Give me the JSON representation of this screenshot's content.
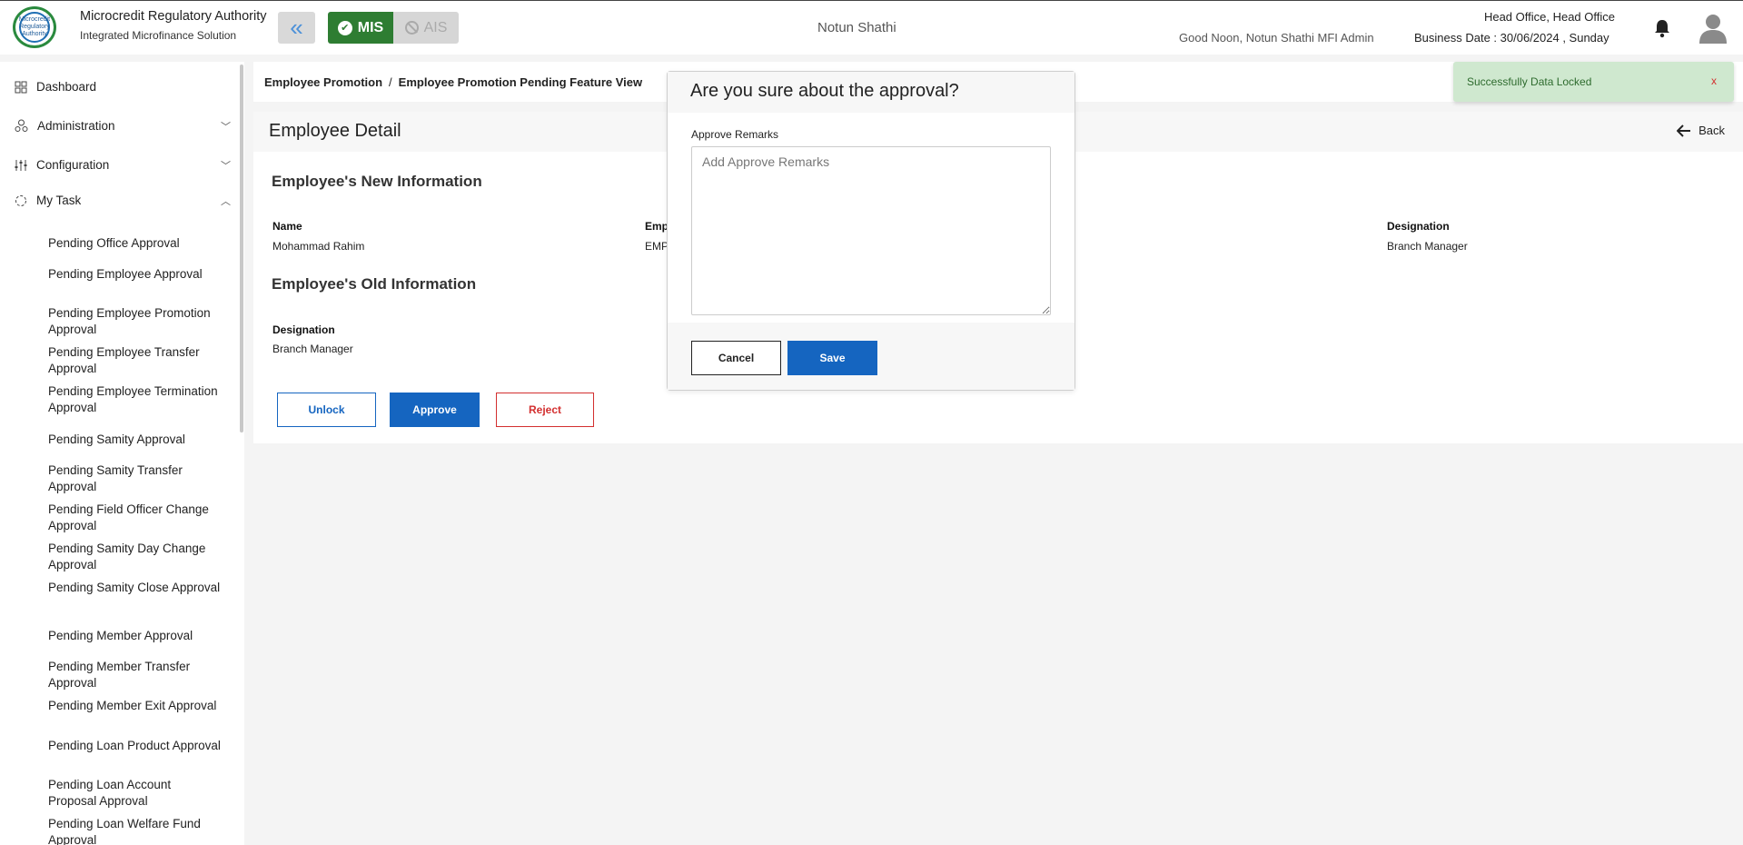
{
  "header": {
    "logo_text": "Microcredit Regulatory Authority",
    "brand_title": "Microcredit Regulatory Authority",
    "brand_subtitle": "Integrated Microfinance Solution",
    "mis_label": "MIS",
    "ais_label": "AIS",
    "organization": "Notun Shathi",
    "greeting": "Good Noon, Notun Shathi MFI Admin",
    "office": "Head Office, Head Office",
    "business_date": "Business Date : 30/06/2024 , Sunday"
  },
  "sidebar": {
    "main_items": [
      {
        "label": "Dashboard",
        "icon": "grid-icon"
      },
      {
        "label": "Administration",
        "icon": "admin-icon"
      },
      {
        "label": "Configuration",
        "icon": "sliders-icon"
      },
      {
        "label": "My Task",
        "icon": "task-icon"
      }
    ],
    "sub_items": [
      "Pending Office Approval",
      "Pending Employee Approval",
      "Pending Employee Promotion Approval",
      "Pending Employee Transfer Approval",
      "Pending Employee Termination Approval",
      "Pending Samity Approval",
      "Pending Samity Transfer Approval",
      "Pending Field Officer Change Approval",
      "Pending Samity Day Change Approval",
      "Pending Samity Close Approval",
      "Pending Member Approval",
      "Pending Member Transfer Approval",
      "Pending Member Exit Approval",
      "Pending Loan Product Approval",
      "Pending Loan Account Proposal Approval",
      "Pending Loan Welfare Fund Approval"
    ]
  },
  "breadcrumb": {
    "parent": "Employee Promotion",
    "separator": "/",
    "current": "Employee Promotion Pending Feature View"
  },
  "page": {
    "title": "Employee Detail",
    "back_label": "Back",
    "new_info_title": "Employee's New Information",
    "old_info_title": "Employee's Old Information",
    "new_info": {
      "name_label": "Name",
      "name_value": "Mohammad Rahim",
      "emp_label_partial": "Emp",
      "emp_value_partial": "EMP",
      "designation_label": "Designation",
      "designation_value": "Branch Manager"
    },
    "old_info": {
      "designation_label": "Designation",
      "designation_value": "Branch Manager"
    },
    "buttons": {
      "unlock": "Unlock",
      "approve": "Approve",
      "reject": "Reject"
    }
  },
  "modal": {
    "title": "Are you sure about the approval?",
    "remarks_label": "Approve Remarks",
    "remarks_placeholder": "Add Approve Remarks",
    "remarks_value": "",
    "cancel_label": "Cancel",
    "save_label": "Save"
  },
  "toast": {
    "message": "Successfully Data Locked",
    "close_label": "x"
  },
  "colors": {
    "primary": "#1565c0",
    "mis_green": "#2e7d32",
    "reject_red": "#d32f2f",
    "toast_bg": "#cfe8cf"
  }
}
